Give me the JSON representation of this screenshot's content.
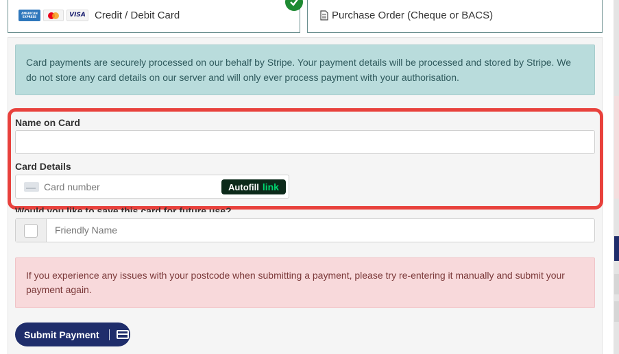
{
  "payment_methods": {
    "card": {
      "label": "Credit / Debit Card",
      "logos": [
        "amex-logo",
        "mastercard-logo",
        "visa-logo"
      ],
      "amex_text": "AMERICAN EXPRESS",
      "visa_text": "VISA",
      "selected": true
    },
    "purchase_order": {
      "label": "Purchase Order (Cheque or BACS)",
      "icon": "document-icon"
    }
  },
  "info_message": "Card payments are securely processed on our behalf by Stripe. Your payment details will be processed and stored by Stripe. We do not store any card details on our server and will only ever process payment with your authorisation.",
  "form": {
    "name_on_card_label": "Name on Card",
    "name_on_card_value": "",
    "card_details_label": "Card Details",
    "card_number_placeholder": "Card number",
    "autofill_label": "Autofill",
    "autofill_brand": "link",
    "save_card_label": "Would you like to save this card for future use?",
    "friendly_name_placeholder": "Friendly Name"
  },
  "warning_message": "If you experience any issues with your postcode when submitting a payment, please try re-entering it manually and submit your payment again.",
  "submit": {
    "label": "Submit Payment",
    "icon": "credit-card-icon"
  },
  "colors": {
    "accent_navy": "#1f2d6b",
    "highlight_red": "#e8413c",
    "info_teal": "#b9dcdc",
    "warning_pink": "#f8d9db",
    "success_green": "#1e8a32",
    "link_green": "#00d66f"
  }
}
